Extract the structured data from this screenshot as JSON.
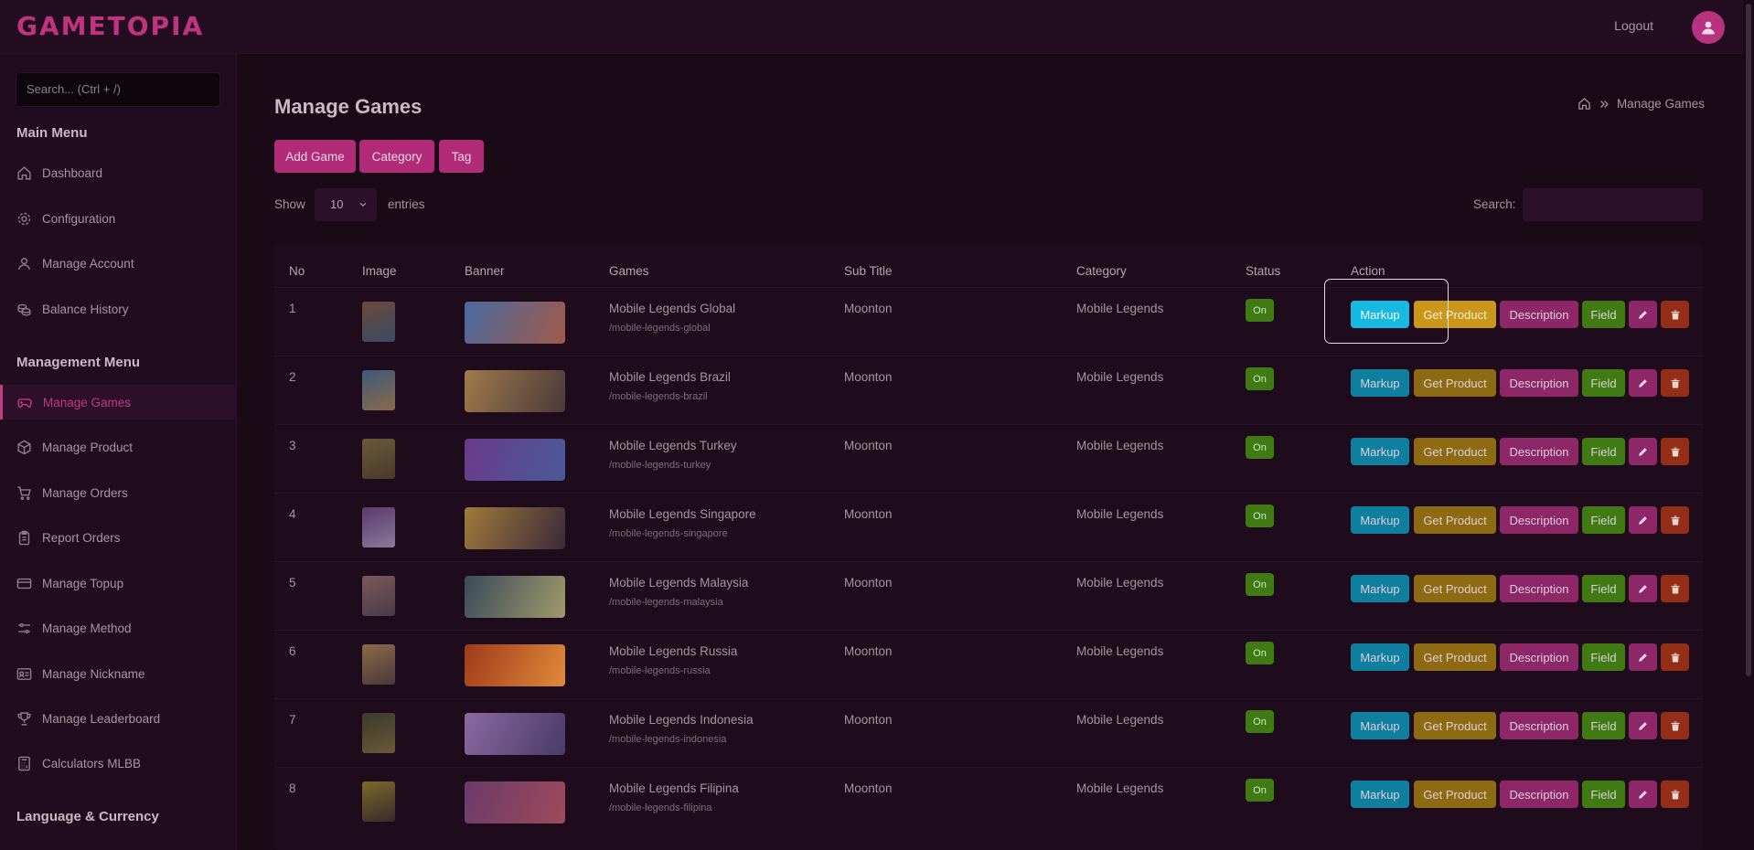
{
  "app": {
    "logo": "GAMETOPIA",
    "logout": "Logout"
  },
  "sidebar": {
    "search_placeholder": "Search... (Ctrl + /)",
    "main_menu": "Main Menu",
    "main_items": [
      {
        "label": "Dashboard",
        "icon": "home-icon"
      },
      {
        "label": "Configuration",
        "icon": "gear-icon"
      },
      {
        "label": "Manage Account",
        "icon": "user-icon"
      },
      {
        "label": "Balance History",
        "icon": "coins-icon"
      }
    ],
    "management_menu": "Management Menu",
    "management_items": [
      {
        "label": "Manage Games",
        "icon": "gamepad-icon",
        "active": true
      },
      {
        "label": "Manage Product",
        "icon": "box-icon"
      },
      {
        "label": "Manage Orders",
        "icon": "cart-icon"
      },
      {
        "label": "Report Orders",
        "icon": "clipboard-icon"
      },
      {
        "label": "Manage Topup",
        "icon": "card-icon"
      },
      {
        "label": "Manage Method",
        "icon": "sliders-icon"
      },
      {
        "label": "Manage Nickname",
        "icon": "id-card-icon"
      },
      {
        "label": "Manage Leaderboard",
        "icon": "trophy-icon"
      },
      {
        "label": "Calculators MLBB",
        "icon": "calculator-icon"
      }
    ],
    "language_menu": "Language & Currency"
  },
  "page": {
    "title": "Manage Games",
    "breadcrumb": "Manage Games",
    "buttons": {
      "add_game": "Add Game",
      "category": "Category",
      "tag": "Tag"
    },
    "show": "Show",
    "entries_value": "10",
    "entries": "entries",
    "search_label": "Search:",
    "search_value": ""
  },
  "table": {
    "headers": {
      "no": "No",
      "image": "Image",
      "banner": "Banner",
      "games": "Games",
      "sub_title": "Sub Title",
      "category": "Category",
      "status": "Status",
      "action": "Action"
    },
    "actions": {
      "markup": "Markup",
      "get_product": "Get Product",
      "description": "Description",
      "field": "Field"
    },
    "rows": [
      {
        "no": "1",
        "game": "Mobile Legends Global",
        "slug": "/mobile-legends-global",
        "sub_title": "Moonton",
        "category": "Mobile Legends",
        "status": "On"
      },
      {
        "no": "2",
        "game": "Mobile Legends Brazil",
        "slug": "/mobile-legends-brazil",
        "sub_title": "Moonton",
        "category": "Mobile Legends",
        "status": "On"
      },
      {
        "no": "3",
        "game": "Mobile Legends Turkey",
        "slug": "/mobile-legends-turkey",
        "sub_title": "Moonton",
        "category": "Mobile Legends",
        "status": "On"
      },
      {
        "no": "4",
        "game": "Mobile Legends Singapore",
        "slug": "/mobile-legends-singapore",
        "sub_title": "Moonton",
        "category": "Mobile Legends",
        "status": "On"
      },
      {
        "no": "5",
        "game": "Mobile Legends Malaysia",
        "slug": "/mobile-legends-malaysia",
        "sub_title": "Moonton",
        "category": "Mobile Legends",
        "status": "On"
      },
      {
        "no": "6",
        "game": "Mobile Legends Russia",
        "slug": "/mobile-legends-russia",
        "sub_title": "Moonton",
        "category": "Mobile Legends",
        "status": "On"
      },
      {
        "no": "7",
        "game": "Mobile Legends Indonesia",
        "slug": "/mobile-legends-indonesia",
        "sub_title": "Moonton",
        "category": "Mobile Legends",
        "status": "On"
      },
      {
        "no": "8",
        "game": "Mobile Legends Filipina",
        "slug": "/mobile-legends-filipina",
        "sub_title": "Moonton",
        "category": "Mobile Legends",
        "status": "On"
      }
    ]
  },
  "colors": {
    "accent": "#c43a85",
    "markup": "#0f7fa0",
    "get_product": "#8e6a12",
    "field": "#3f7a13",
    "delete": "#952e17"
  }
}
